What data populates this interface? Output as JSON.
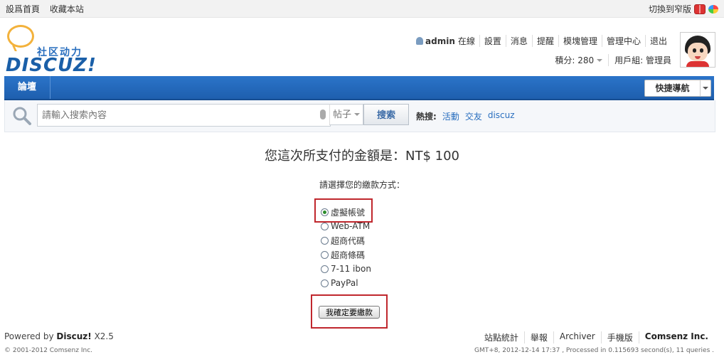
{
  "topbar": {
    "links": [
      "設爲首頁",
      "收藏本站"
    ],
    "switch_label": "切換到窄版"
  },
  "logo": {
    "cn_text": "社区动力",
    "en_text": "DISCUZ!"
  },
  "user": {
    "name": "admin",
    "status": "在線",
    "menu": [
      "設置",
      "消息",
      "提醒",
      "模塊管理",
      "管理中心",
      "退出"
    ],
    "credits_label": "積分: 280",
    "group_label": "用戶組: 管理員"
  },
  "nav": {
    "tab": "論壇",
    "quick_nav": "快捷導航"
  },
  "search": {
    "placeholder": "請輸入搜索內容",
    "type": "帖子",
    "button": "搜索",
    "hot_label": "熱搜:",
    "hot_links": [
      "活動",
      "交友",
      "discuz"
    ]
  },
  "payment": {
    "amount_text": "您這次所支付的金額是：NT$ 100",
    "prompt": "請選擇您的繳款方式：",
    "options": [
      "虛擬帳號",
      "Web-ATM",
      "超商代碼",
      "超商條碼",
      "7-11 ibon",
      "PayPal"
    ],
    "selected_index": 0,
    "confirm_button": "我確定要繳款"
  },
  "footer": {
    "powered_prefix": "Powered by",
    "powered_brand": "Discuz!",
    "powered_version": "X2.5",
    "copyright": "© 2001-2012 Comsenz Inc.",
    "links": [
      "站點統計",
      "舉報",
      "Archiver",
      "手機版"
    ],
    "company": "Comsenz Inc.",
    "timing": "GMT+8, 2012-12-14 17:37 , Processed in 0.115693 second(s), 11 queries ."
  },
  "colors": {
    "nav_blue": "#1e5fae",
    "link_blue": "#2a6fbf",
    "highlight_red": "#c0272d"
  }
}
